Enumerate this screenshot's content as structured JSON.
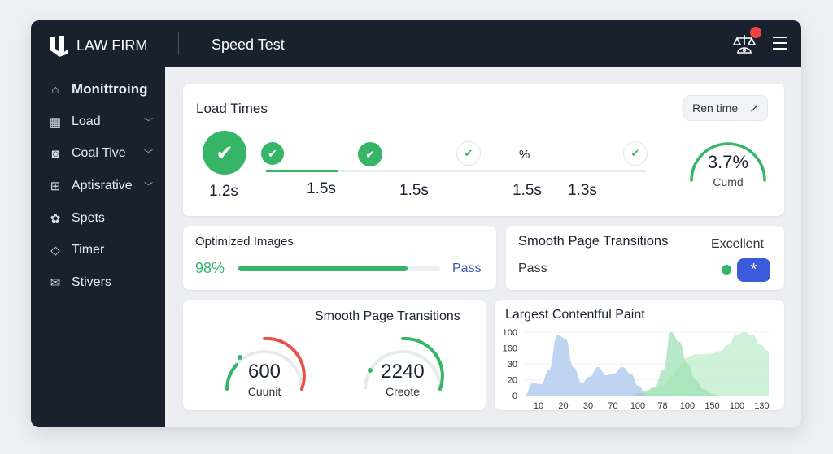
{
  "header": {
    "brand": "LAW FIRM",
    "title": "Speed Test"
  },
  "sidebar": {
    "items": [
      {
        "label": "Monittroing",
        "icon": "home-icon",
        "chevron": false
      },
      {
        "label": "Load",
        "icon": "grid-icon",
        "chevron": true
      },
      {
        "label": "Coal Tive",
        "icon": "camera-icon",
        "chevron": true
      },
      {
        "label": "Aptisrative",
        "icon": "calendar-plus-icon",
        "chevron": true
      },
      {
        "label": "Spets",
        "icon": "puzzle-icon",
        "chevron": false
      },
      {
        "label": "Timer",
        "icon": "tag-icon",
        "chevron": false
      },
      {
        "label": "Stivers",
        "icon": "mail-icon",
        "chevron": false
      }
    ]
  },
  "load_times": {
    "title": "Load Times",
    "button": "Ren time",
    "values": [
      "1.2s",
      "1.5s",
      "1.5s",
      "1.5s",
      "1.3s"
    ],
    "percent_label": "%",
    "progress": 0.19,
    "gauge": {
      "value": "3.7%",
      "label": "Cumd",
      "fraction": 0.9
    }
  },
  "optimized": {
    "title": "Optimized Images",
    "percent": "98%",
    "fraction": 0.84,
    "status": "Pass"
  },
  "transitions": {
    "title": "Smooth Page Transitions",
    "status": "Pass",
    "rating": "Excellent"
  },
  "gauges": {
    "title": "Smooth Page Transitions",
    "items": [
      {
        "value": "600",
        "label": "Cuunit"
      },
      {
        "value": "2240",
        "label": "Creote"
      }
    ]
  },
  "colors": {
    "green": "#36b567",
    "blue": "#3b5bdb",
    "red": "#e5534b",
    "dark": "#1a212e"
  },
  "chart_data": {
    "type": "area",
    "title": "Largest Contentful Paint",
    "yticks": [
      "100",
      "160",
      "30",
      "20",
      "0"
    ],
    "xticks": [
      "10",
      "20",
      "30",
      "70",
      "100",
      "78",
      "100",
      "150",
      "100",
      "130"
    ],
    "ylim": [
      0,
      100
    ],
    "series": [
      {
        "name": "blue",
        "color": "#a9c6ec",
        "values": [
          0,
          20,
          18,
          40,
          95,
          90,
          45,
          20,
          30,
          45,
          32,
          35,
          45,
          35,
          15,
          0,
          0,
          0,
          0,
          0,
          0,
          0,
          0,
          0,
          0,
          0,
          0,
          0,
          0,
          0,
          0
        ]
      },
      {
        "name": "green-peak",
        "color": "#9fe0b4",
        "values": [
          0,
          0,
          0,
          0,
          0,
          0,
          0,
          0,
          0,
          0,
          0,
          0,
          0,
          0,
          4,
          8,
          14,
          40,
          100,
          85,
          50,
          25,
          10,
          3,
          0,
          0,
          0,
          0,
          0,
          0,
          0
        ]
      },
      {
        "name": "green-broad",
        "color": "#bdeccb",
        "values": [
          0,
          0,
          0,
          0,
          0,
          0,
          0,
          0,
          0,
          0,
          0,
          0,
          0,
          0,
          2,
          5,
          10,
          15,
          30,
          45,
          60,
          65,
          65,
          66,
          70,
          80,
          95,
          100,
          95,
          80,
          70
        ]
      }
    ]
  }
}
